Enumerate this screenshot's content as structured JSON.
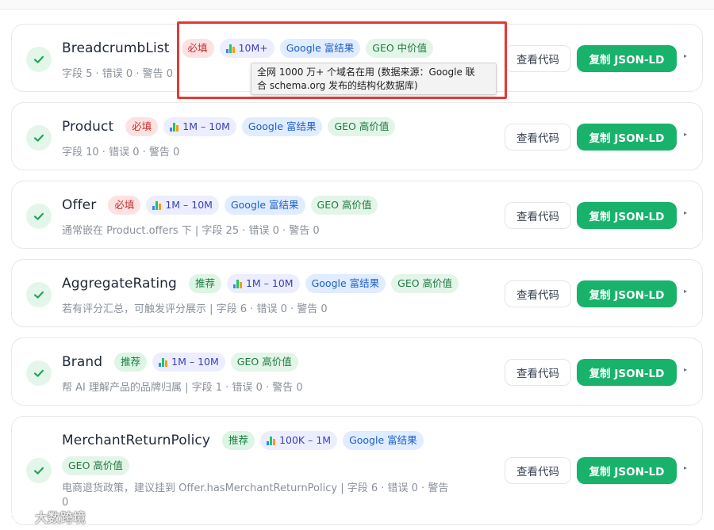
{
  "labels": {
    "view_code": "查看代码",
    "copy_jsonld": "复制 JSON-LD"
  },
  "cards": [
    {
      "name": "BreadcrumbList",
      "level": "必填",
      "usage": "10M+",
      "google": "Google 富结果",
      "geo": "GEO 中价值",
      "meta": "字段 5 · 错误 0 · 警告 0"
    },
    {
      "name": "Product",
      "level": "必填",
      "usage": "1M – 10M",
      "google": "Google 富结果",
      "geo": "GEO 高价值",
      "meta": "字段 10 · 错误 0 · 警告 0"
    },
    {
      "name": "Offer",
      "level": "必填",
      "usage": "1M – 10M",
      "google": "Google 富结果",
      "geo": "GEO 高价值",
      "meta": "通常嵌在 Product.offers 下 | 字段 25 · 错误 0 · 警告 0"
    },
    {
      "name": "AggregateRating",
      "level": "推荐",
      "usage": "1M – 10M",
      "google": "Google 富结果",
      "geo": "GEO 高价值",
      "meta": "若有评分汇总，可触发评分展示 | 字段 6 · 错误 0 · 警告 0"
    },
    {
      "name": "Brand",
      "level": "推荐",
      "usage": "1M – 10M",
      "geo": "GEO 高价值",
      "meta": "帮 AI 理解产品的品牌归属 | 字段 1 · 错误 0 · 警告 0"
    },
    {
      "name": "MerchantReturnPolicy",
      "level": "推荐",
      "usage": "100K – 1M",
      "google": "Google 富结果",
      "geo": "GEO 高价值",
      "meta_line1": "电商退货政策，建议挂到 Offer.hasMerchantReturnPolicy | 字段 6 · 错误 0 · 警告",
      "meta_line2": "0"
    }
  ],
  "tooltip": {
    "line1": "全网 1000 万+ 个域名在用 (数据来源：Google 联",
    "line2": "合 schema.org 发布的结构化数据库)"
  },
  "watermark": "大数跨境",
  "icons": {
    "check": "check-icon",
    "usage": "bar-chart-icon",
    "more": "caret-right-icon"
  },
  "colors": {
    "accent_green": "#18b26b",
    "highlight_red": "#e53935"
  }
}
